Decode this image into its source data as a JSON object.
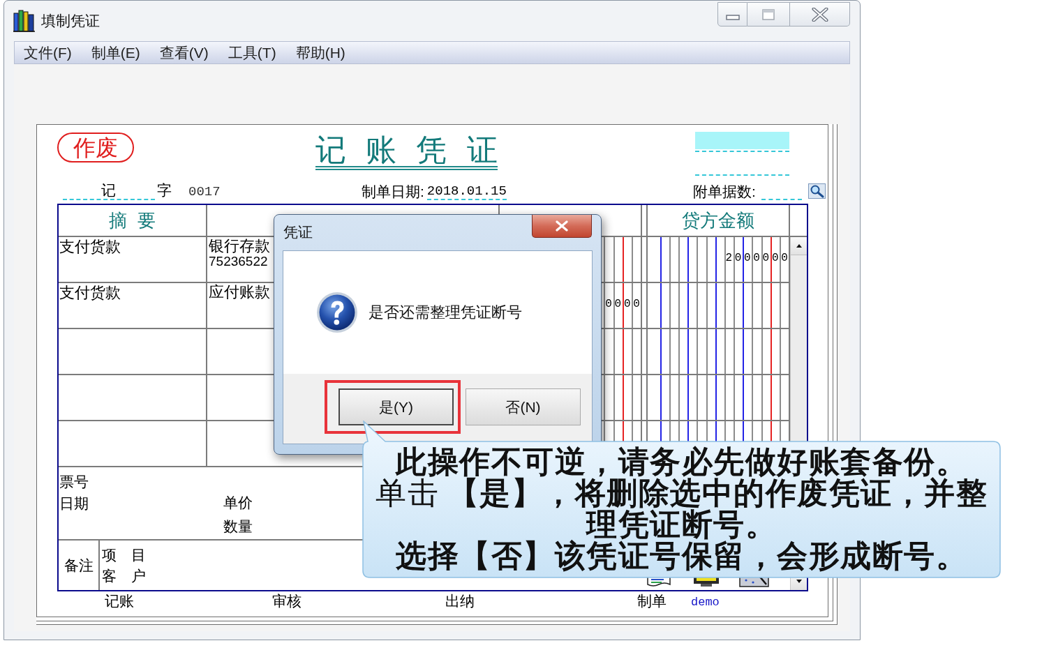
{
  "window": {
    "title": "填制凭证"
  },
  "menu": [
    {
      "label": "文件(F)"
    },
    {
      "label": "制单(E)"
    },
    {
      "label": "查看(V)"
    },
    {
      "label": "工具(T)"
    },
    {
      "label": "帮助(H)"
    }
  ],
  "voucher": {
    "stamp": "作废",
    "title": "记 账 凭 证",
    "type": "记",
    "type_suffix": "字",
    "number": "0017",
    "date_label": "制单日期:",
    "date": "2018.01.15",
    "attachments_label": "附单据数:",
    "headers": {
      "summary": "摘 要",
      "credit": "贷方金额"
    },
    "rows": [
      {
        "summary": "支付货款",
        "account": "银行存款",
        "account_code": "75236522",
        "credit": "2000000"
      },
      {
        "summary": "支付货款",
        "account": "应付账款",
        "debit": "0000"
      }
    ],
    "footer": {
      "ticket_no": "票号",
      "date": "日期",
      "unit_price": "单价",
      "quantity": "数量",
      "remarks": "备注",
      "project": "项　目",
      "customer": "客　户"
    },
    "signatures": [
      {
        "label": "记账"
      },
      {
        "label": "审核"
      },
      {
        "label": "出纳"
      },
      {
        "label": "制单",
        "value": "demo"
      }
    ]
  },
  "dialog": {
    "title": "凭证",
    "message": "是否还需整理凭证断号",
    "buttons": [
      {
        "label": "是(Y)",
        "default": true,
        "highlighted": true
      },
      {
        "label": "否(N)",
        "default": false,
        "highlighted": false
      }
    ]
  },
  "callout": {
    "paragraphs": [
      {
        "text": "此操作不可逆，请务必先做好账套备份。",
        "bold": true
      },
      {
        "text": "单击 **【是】，将删除选中的作废凭证，并整理凭证断号。**",
        "bold": false
      },
      {
        "text": "选择【否】该凭证号保留，会形成断号。",
        "bold": true
      }
    ]
  }
}
